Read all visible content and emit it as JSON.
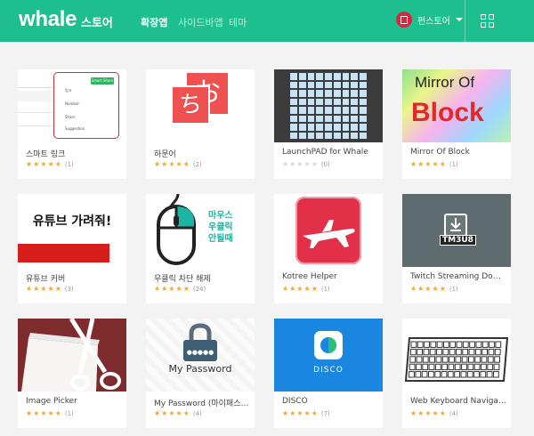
{
  "header": {
    "logo": "whale",
    "logo_sub": "스토어",
    "nav": [
      {
        "label": "확장앱",
        "active": true
      },
      {
        "label": "사이드바앱",
        "active": false
      },
      {
        "label": "테마",
        "active": false
      }
    ],
    "user_name": "펀스토어"
  },
  "cards": [
    {
      "title": "스마트 링크",
      "rating": 5,
      "count": "(1)",
      "thumb": "smart-link",
      "menu_items": [
        "링크",
        "Number",
        "Share",
        "Suggestion"
      ],
      "menu_button": "Smart Share"
    },
    {
      "title": "하문어",
      "rating": 5,
      "count": "(2)",
      "thumb": "kana",
      "glyph_top": "お",
      "glyph_bottom": "ち"
    },
    {
      "title": "LaunchPAD for Whale",
      "rating": 0,
      "count": "(0)",
      "thumb": "launchpad"
    },
    {
      "title": "Mirror Of Block",
      "rating": 5,
      "count": "(1)",
      "thumb": "mirror",
      "line1": "Mirror Of",
      "line2": "Block"
    },
    {
      "title": "유튜브 커버",
      "rating": 5,
      "count": "(3)",
      "thumb": "yt",
      "text": "유튜브 가려줘!"
    },
    {
      "title": "우클릭 차단 해제",
      "rating": 5,
      "count": "(24)",
      "thumb": "mouse",
      "text_lines": [
        "마우스",
        "우클릭",
        "안될때"
      ]
    },
    {
      "title": "Kotree Helper",
      "rating": 5,
      "count": "(1)",
      "thumb": "kotree"
    },
    {
      "title": "Twitch Streaming Downl...",
      "rating": 5,
      "count": "(1)",
      "thumb": "twitch",
      "badge": "TM3U8"
    },
    {
      "title": "Image Picker",
      "rating": 5,
      "count": "(1)",
      "thumb": "scissors"
    },
    {
      "title": "My Password (마이패스워...",
      "rating": 5,
      "count": "(4)",
      "thumb": "password",
      "caption": "My Password",
      "lock_text": "●●●●●"
    },
    {
      "title": "DISCO",
      "rating": 5,
      "count": "(7)",
      "thumb": "disco",
      "caption": "DISCO"
    },
    {
      "title": "Web Keyboard Navigator",
      "rating": 5,
      "count": "(4)",
      "thumb": "keyboard"
    }
  ],
  "colors": {
    "header_bg": "#1ebf8e",
    "star": "#f5a623"
  }
}
